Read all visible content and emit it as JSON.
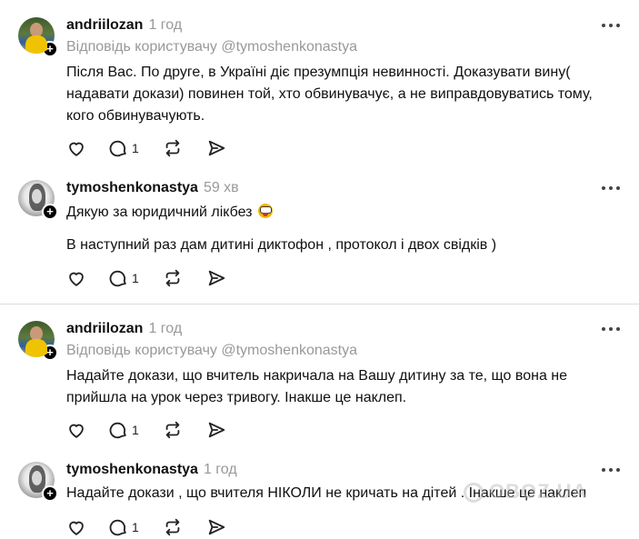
{
  "watermark": "OBOZ.UA",
  "icons": {
    "like": "heart-icon",
    "comment": "comment-icon",
    "repost": "repost-icon",
    "share": "share-icon",
    "more": "more-icon",
    "follow": "plus-icon"
  },
  "posts": [
    {
      "username": "andriilozan",
      "time": "1 год",
      "reply_to": "Відповідь користувачу @tymoshenkonastya",
      "lines": [
        "Після Вас. По друге, в Україні діє презумпція невинності. Доказувати вину(",
        "надавати докази) повинен той, хто обвинувачує, а не виправдовуватись тому,",
        "кого обвинувачують."
      ],
      "comment_count": "1"
    },
    {
      "username": "tymoshenkonastya",
      "time": "59 хв",
      "lines": [
        "Дякую за юридичний лікбез",
        "В наступний раз дам дитині диктофон , протокол і двох свідків )"
      ],
      "comment_count": "1"
    },
    {
      "username": "andriilozan",
      "time": "1 год",
      "reply_to": "Відповідь користувачу @tymoshenkonastya",
      "lines": [
        "Надайте докази, що вчитель накричала на Вашу дитину за те, що вона не",
        "прийшла на урок через тривогу. Інакше це наклеп."
      ],
      "comment_count": "1"
    },
    {
      "username": "tymoshenkonastya",
      "time": "1 год",
      "lines": [
        "Надайте докази , що вчителя НІКОЛИ не кричать на дітей . Інакше це наклеп"
      ],
      "comment_count": "1"
    }
  ]
}
